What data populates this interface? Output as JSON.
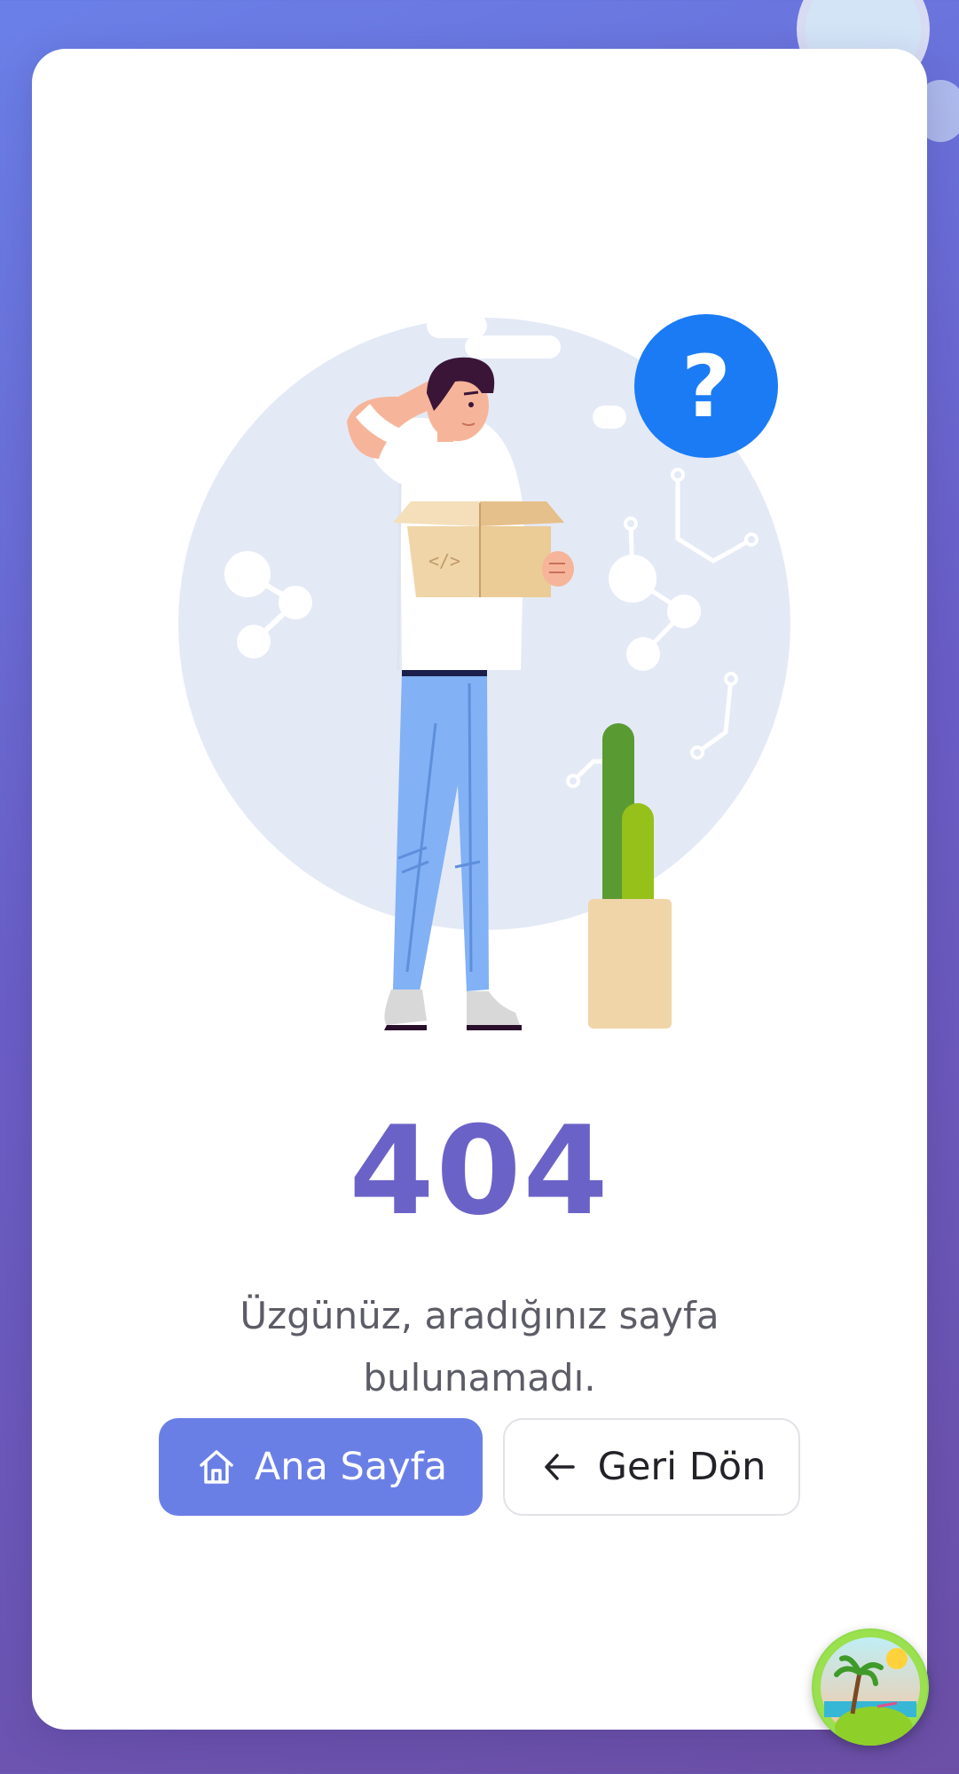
{
  "error": {
    "code": "404",
    "message": "Üzgünüz, aradığınız sayfa bulunamadı."
  },
  "illustration": {
    "badge_glyph": "?",
    "box_glyph": "</>"
  },
  "buttons": {
    "home": {
      "label": "Ana Sayfa",
      "icon": "home-icon"
    },
    "back": {
      "label": "Geri Dön",
      "icon": "arrow-left-icon"
    }
  },
  "colors": {
    "accent": "#6b62c8",
    "primary_button": "#6a7fe6",
    "question_badge": "#1b7bf5",
    "background_start": "#6a80e8",
    "background_end": "#6c4fa6"
  },
  "floating_widget": {
    "icon": "beach-island-icon"
  }
}
